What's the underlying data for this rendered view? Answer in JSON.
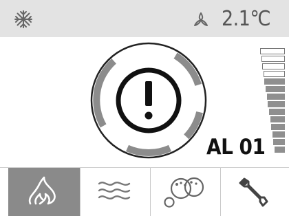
{
  "status_bar": {
    "mode_icon": "snowflake-icon",
    "fan_icon": "fan-icon",
    "temperature": "2.1℃"
  },
  "alarm": {
    "icon": "exclamation-circle-icon",
    "code": "AL 01"
  },
  "level_meter": {
    "segments_total": 14,
    "segments_filled": 10,
    "fill_color": "#8f8f8f"
  },
  "nav": {
    "tabs": [
      {
        "icon": "defrost-flame-icon",
        "active": true
      },
      {
        "icon": "airflow-waves-icon",
        "active": false
      },
      {
        "icon": "bubbles-icon",
        "active": false
      },
      {
        "icon": "wrench-icon",
        "active": false
      }
    ]
  },
  "colors": {
    "status_bar_bg": "#e3e3e3",
    "active_tab_bg": "#8a8a8a",
    "ring_segment": "#8c8c8c"
  }
}
